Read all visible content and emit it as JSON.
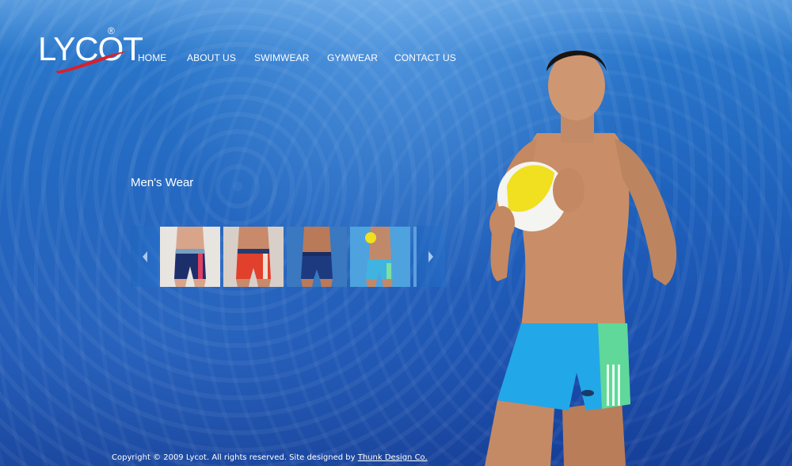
{
  "brand": {
    "logo_text": "LYCOT",
    "registered": "®"
  },
  "nav": {
    "items": [
      {
        "label": "HOME"
      },
      {
        "label": "ABOUT US"
      },
      {
        "label": "SWIMWEAR"
      },
      {
        "label": "GYMWEAR"
      },
      {
        "label": "CONTACT US"
      }
    ]
  },
  "main": {
    "section_title": "Men's Wear",
    "thumbnails": [
      {
        "shorts_color": "#1d2f6b",
        "accent": "#e04060",
        "band": "#7aa0c0"
      },
      {
        "shorts_color": "#e0402c",
        "accent": "#f0e0d0",
        "band": "#263a70"
      },
      {
        "shorts_color": "#1d3a80",
        "accent": "#2b4b95",
        "band": "#1a2d60"
      },
      {
        "shorts_color": "#3fb4e0",
        "accent": "#7ce0a0",
        "band": "#2a90c8"
      }
    ]
  },
  "hero": {
    "shorts_color": "#22a8e8",
    "panel_color": "#5fd89a",
    "ball_color": "#f0e020"
  },
  "footer": {
    "text": "Copyright © 2009 Lycot. All rights reserved. Site designed by",
    "link": "Thunk Design Co."
  },
  "icons": {
    "prev": "chevron-left-icon",
    "next": "chevron-right-icon"
  }
}
